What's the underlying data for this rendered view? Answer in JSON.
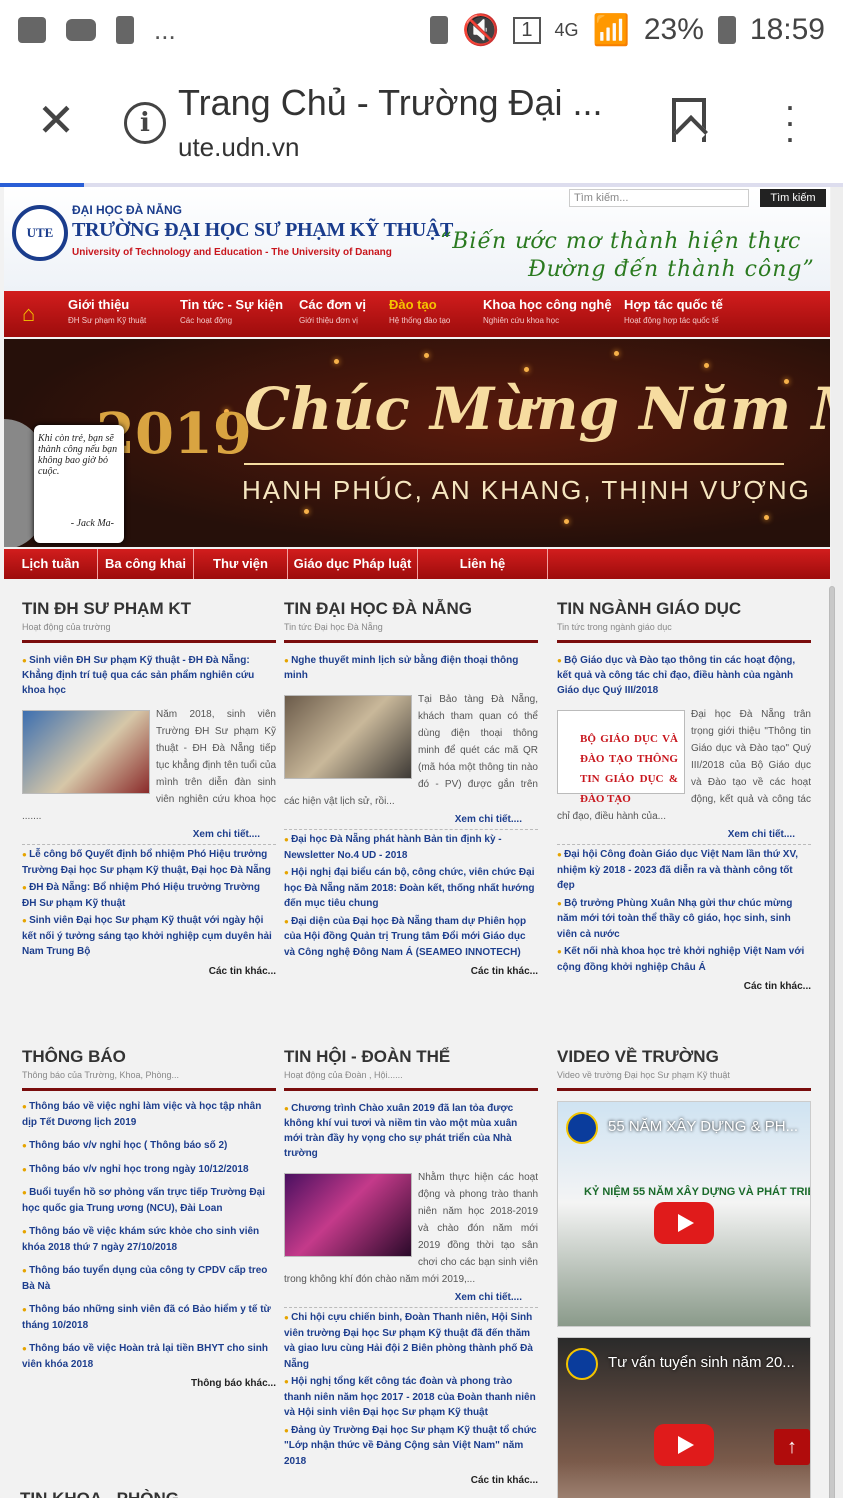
{
  "status_bar": {
    "battery": "23%",
    "time": "18:59",
    "network": "4G",
    "sim": "1",
    "overflow": "..."
  },
  "browser": {
    "title": "Trang Chủ - Trường Đại ...",
    "url": "ute.udn.vn",
    "progress": 0.1
  },
  "header": {
    "logo_text": "UTE",
    "uni_top": "ĐẠI HỌC ĐÀ NẴNG",
    "uni_name": "TRƯỜNG ĐẠI HỌC SƯ PHẠM KỸ THUẬT",
    "uni_en": "University of Technology and Education - The University of Danang",
    "slogan_1": "“Biến ước mơ thành hiện thực",
    "slogan_2": "Đường đến thành công”",
    "search_placeholder": "Tìm kiếm...",
    "search_button": "Tìm kiếm"
  },
  "nav": [
    {
      "label": "Giới thiệu",
      "sub": "ĐH Sư phạm Kỹ thuật"
    },
    {
      "label": "Tin tức - Sự kiện",
      "sub": "Các hoạt động"
    },
    {
      "label": "Các đơn vị",
      "sub": "Giới thiệu đơn vị"
    },
    {
      "label": "Đào tạo",
      "sub": "Hệ thống đào tạo"
    },
    {
      "label": "Khoa học công nghệ",
      "sub": "Nghiên cứu khoa học"
    },
    {
      "label": "Hợp tác quốc tế",
      "sub": "Hoạt động hợp tác quốc tế"
    }
  ],
  "banner": {
    "title": "Chúc Mừng Năm Mới",
    "subtitle": "HẠNH PHÚC, AN KHANG, THỊNH VƯỢNG",
    "year": "2019",
    "quote": "Khi còn trẻ, bạn sẽ thành công nếu bạn không bao giờ bỏ cuộc.",
    "quote_author": "- Jack Ma-"
  },
  "subnav": [
    "Lịch tuần",
    "Ba công khai",
    "Thư viện",
    "Giáo dục Pháp luật",
    "Liên hệ"
  ],
  "sections": {
    "tin_dh_spkt": {
      "title": "TIN ĐH SƯ PHẠM KT",
      "sub": "Hoạt động của trường",
      "lead": "Sinh viên ĐH Sư phạm Kỹ thuật - ĐH Đà Nẵng: Khẳng định trí tuệ qua các sản phẩm nghiên cứu khoa học",
      "body": "Năm 2018, sinh viên Trường ĐH Sư phạm Kỹ thuật - ĐH Đà Nẵng tiếp tục khẳng định tên tuổi của mình trên diễn đàn sinh viên nghiên cứu khoa học .......",
      "more": "Xem chi tiết....",
      "links": [
        "Lễ công bố Quyết định bổ nhiệm Phó Hiệu trưởng Trường Đại học Sư phạm Kỹ thuật, Đại học Đà Nẵng",
        "ĐH Đà Nẵng: Bổ nhiệm Phó Hiệu trưởng Trường ĐH Sư phạm Kỹ thuật",
        "Sinh viên Đại học Sư phạm Kỹ thuật với ngày hội kết nối ý tưởng sáng tạo khởi nghiệp cụm duyên hải Nam Trung Bộ"
      ],
      "other": "Các tin khác..."
    },
    "tin_dhdn": {
      "title": "TIN ĐẠI HỌC ĐÀ NẴNG",
      "sub": "Tin tức Đại học Đà Nẵng",
      "lead": "Nghe thuyết minh lịch sử bằng điện thoại thông minh",
      "body": "Tại Bảo tàng Đà Nẵng, khách tham quan có thể dùng điện thoại thông minh để quét các mã QR (mã hóa một thông tin nào đó - PV) được gắn trên các hiện vật lịch sử, rồi...",
      "more": "Xem chi tiết....",
      "links": [
        "Đại học Đà Nẵng phát hành Bản tin định kỳ - Newsletter No.4 UD - 2018",
        "Hội nghị đại biểu cán bộ, công chức, viên chức Đại học Đà Nẵng năm 2018: Đoàn kết, thống nhất hướng đến mục tiêu chung",
        "Đại diện của Đại học Đà Nẵng tham dự Phiên họp của Hội đồng Quản trị Trung tâm Đổi mới Giáo dục và Công nghệ Đông Nam Á (SEAMEO INNOTECH)"
      ],
      "other": "Các tin khác..."
    },
    "tin_nganh": {
      "title": "TIN NGÀNH GIÁO DỤC",
      "sub": "Tin tức trong ngành giáo dục",
      "lead": "Bộ Giáo dục và Đào tạo thông tin các hoạt động, kết quả và công tác chỉ đạo, điều hành của ngành Giáo dục Quý III/2018",
      "thumb_caption": "BỘ GIÁO DỤC VÀ ĐÀO TẠO THÔNG TIN GIÁO DỤC & ĐÀO TẠO",
      "body": "Đại học Đà Nẵng trân trọng giới thiệu \"Thông tin Giáo dục và Đào tạo\" Quý III/2018 của Bộ Giáo dục và Đào tạo về các hoạt động, kết quả và công tác chỉ đạo, điều hành của...",
      "more": "Xem chi tiết....",
      "links": [
        "Đại hội Công đoàn Giáo dục Việt Nam lần thứ XV, nhiệm kỳ 2018 - 2023 đã diễn ra và thành công tốt đẹp",
        "Bộ trưởng Phùng Xuân Nhạ gửi thư chúc mừng năm mới tới toàn thể thầy cô giáo, học sinh, sinh viên cả nước",
        "Kết nối nhà khoa học trẻ khởi nghiệp Việt Nam với cộng đồng khởi nghiệp Châu Á"
      ],
      "other": "Các tin khác..."
    },
    "thong_bao": {
      "title": "THÔNG BÁO",
      "sub": "Thông báo của Trường, Khoa, Phòng...",
      "items": [
        "Thông báo về việc nghỉ làm việc và học tập nhân dịp Tết Dương lịch 2019",
        "Thông báo v/v nghỉ học ( Thông báo số 2)",
        "Thông báo v/v nghỉ học trong ngày 10/12/2018",
        "Buổi tuyển hồ sơ phỏng vấn trực tiếp Trường Đại học quốc gia Trung ương (NCU), Đài Loan",
        "Thông báo về việc khám sức khỏe cho sinh viên khóa 2018 thứ 7 ngày 27/10/2018",
        "Thông báo tuyển dụng của công ty CPDV cấp treo Bà Nà",
        "Thông báo những sinh viên đã có Bảo hiểm y tế từ tháng 10/2018",
        "Thông báo về việc Hoàn trả lại tiền BHYT cho sinh viên khóa 2018"
      ],
      "other": "Thông báo khác..."
    },
    "tin_hoi": {
      "title": "TIN HỘI - ĐOÀN THỂ",
      "sub": "Hoạt động của Đoàn , Hội......",
      "lead": "Chương trình Chào xuân 2019 đã lan tỏa được không khí vui tươi và niềm tin vào một mùa xuân mới tràn đầy hy vọng cho sự phát triển của Nhà trường",
      "body": "Nhằm thực hiện các hoạt động và phong trào thanh niên năm học 2018-2019 và chào đón năm mới 2019 đồng thời tạo sân chơi cho các bạn sinh viên trong không khí đón chào năm mới 2019,...",
      "more": "Xem chi tiết....",
      "links": [
        "Chi hội cựu chiến binh, Đoàn Thanh niên, Hội Sinh viên trường Đại học Sư phạm Kỹ thuật đã đến thăm và giao lưu cùng Hải đội 2 Biên phòng thành phố Đà Nẵng",
        "Hội nghị tổng kết công tác đoàn và phong trào thanh niên năm học 2017 - 2018 của Đoàn thanh niên và Hội sinh viên Đại học Sư phạm Kỹ thuật",
        "Đảng ủy Trường Đại học Sư phạm Kỹ thuật tổ chức \"Lớp nhận thức về Đảng Cộng sản Việt Nam\" năm 2018"
      ],
      "other": "Các tin khác..."
    },
    "video": {
      "title": "VIDEO VỀ TRƯỜNG",
      "sub": "Video về trường Đại học Sư phạm Kỹ thuật",
      "videos": [
        {
          "title": "55 NĂM XÂY DỰNG & PH...",
          "caption": "KỶ NIỆM 55 NĂM XÂY DỰNG VÀ PHÁT TRIỂN"
        },
        {
          "title": "Tư vấn tuyển sinh năm 20..."
        }
      ]
    }
  },
  "bottom_section_title": "TIN KHOA - PHÒNG",
  "colors": {
    "brand_red": "#c8161d",
    "nav_dark": "#9d0c0c",
    "link_blue": "#1d3e8d",
    "accent_gold": "#f5c400"
  }
}
